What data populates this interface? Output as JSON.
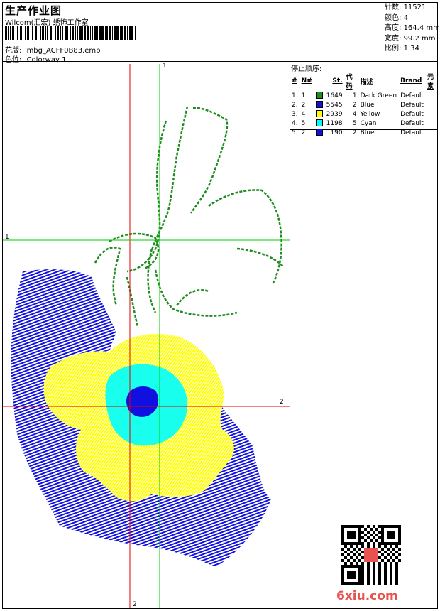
{
  "header": {
    "title": "生产作业图",
    "company": "Wilcom(汇宏) 绣饰工作室",
    "design_label": "花版:",
    "design_value": "mbg_ACFF0B83.emb",
    "colorway_label": "色位:",
    "colorway_value": "Colorway 1"
  },
  "stats": {
    "stitches_label": "针数:",
    "stitches_value": "11521",
    "colors_label": "颜色:",
    "colors_value": "4",
    "height_label": "高度:",
    "height_value": "164.4 mm",
    "width_label": "宽度:",
    "width_value": "99.2 mm",
    "scale_label": "比例:",
    "scale_value": "1.34"
  },
  "stop_sequence": {
    "title": "停止顺序:",
    "headers": [
      "#",
      "N#",
      "St.",
      "代码",
      "描述",
      "Brand",
      "元素"
    ],
    "rows": [
      {
        "idx": "1.",
        "n": "1",
        "color": "#1e8c1e",
        "st": "1649",
        "code": "1",
        "desc": "Dark Green",
        "brand": "Default"
      },
      {
        "idx": "2.",
        "n": "2",
        "color": "#1010e0",
        "st": "5545",
        "code": "2",
        "desc": "Blue",
        "brand": "Default"
      },
      {
        "idx": "3.",
        "n": "4",
        "color": "#ffff00",
        "st": "2939",
        "code": "4",
        "desc": "Yellow",
        "brand": "Default"
      },
      {
        "idx": "4.",
        "n": "5",
        "color": "#00ffff",
        "st": "1198",
        "code": "5",
        "desc": "Cyan",
        "brand": "Default"
      },
      {
        "idx": "5.",
        "n": "2",
        "color": "#1010e0",
        "st": "190",
        "code": "2",
        "desc": "Blue",
        "brand": "Default"
      }
    ]
  },
  "axes": {
    "vertical_top_label": "1",
    "vertical_bottom_label": "2",
    "horizontal_left_label": "1",
    "horizontal_right_label": "2"
  },
  "watermark": "6xiu.com",
  "colors": {
    "green": "#1e8c1e",
    "blue": "#1010e0",
    "yellow": "#ffff00",
    "cyan": "#00ffff",
    "axis_red": "#e00000",
    "axis_green": "#00cc00"
  }
}
